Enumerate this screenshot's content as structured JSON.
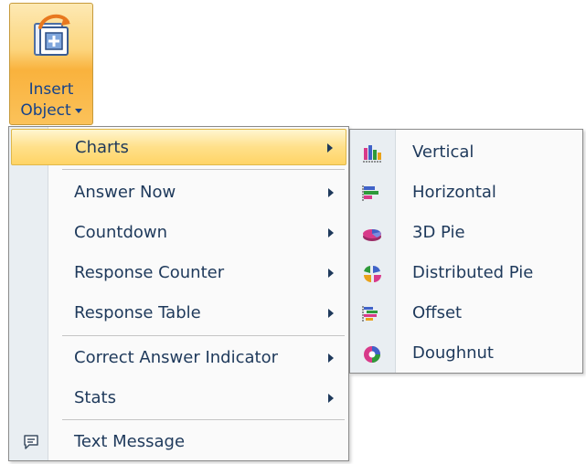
{
  "ribbon": {
    "button": {
      "line1": "Insert",
      "line2": "Object",
      "icon": "insert-object-icon"
    }
  },
  "menu": {
    "items": [
      {
        "label": "Charts",
        "has_submenu": true,
        "highlighted": true
      },
      {
        "label": "Answer Now",
        "has_submenu": true
      },
      {
        "label": "Countdown",
        "has_submenu": true
      },
      {
        "label": "Response Counter",
        "has_submenu": true
      },
      {
        "label": "Response Table",
        "has_submenu": true
      },
      {
        "label": "Correct Answer Indicator",
        "has_submenu": true
      },
      {
        "label": "Stats",
        "has_submenu": true
      },
      {
        "label": "Text Message",
        "icon": "text-message-icon"
      }
    ]
  },
  "submenu": {
    "items": [
      {
        "label": "Vertical",
        "icon": "vertical-bar-chart-icon"
      },
      {
        "label": "Horizontal",
        "icon": "horizontal-bar-chart-icon"
      },
      {
        "label": "3D Pie",
        "icon": "3d-pie-chart-icon"
      },
      {
        "label": "Distributed Pie",
        "icon": "distributed-pie-chart-icon"
      },
      {
        "label": "Offset",
        "icon": "offset-bar-chart-icon"
      },
      {
        "label": "Doughnut",
        "icon": "doughnut-chart-icon"
      }
    ]
  },
  "colors": {
    "text": "#1e395b",
    "ribbon_text": "#15428b",
    "highlight": "#ffe08a",
    "gutter": "#e9eef2"
  }
}
